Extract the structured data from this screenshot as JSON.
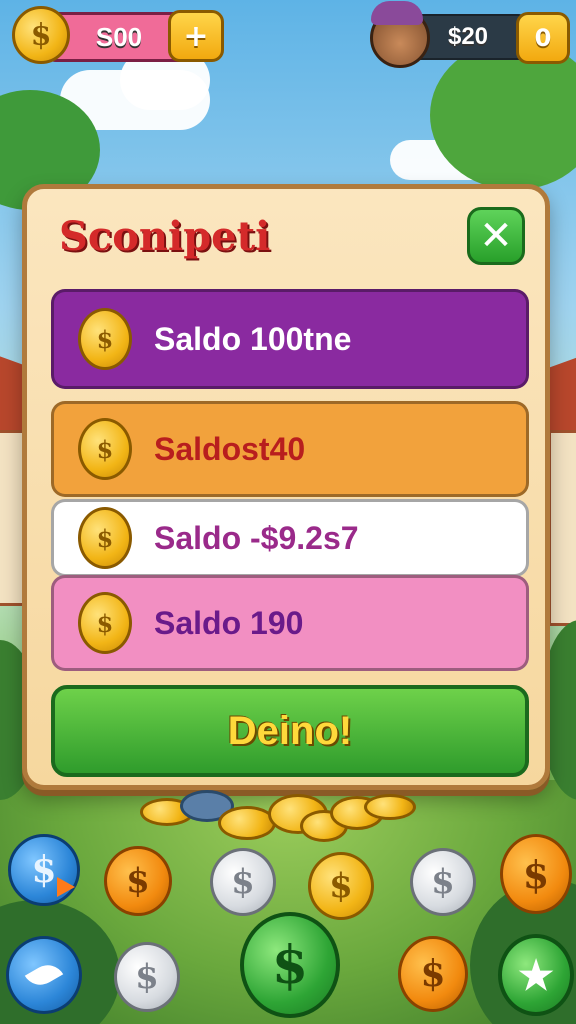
{
  "hud": {
    "coins_value": "S00",
    "coin_icon_glyph": "$",
    "plus_glyph": "+",
    "player_money": "$20",
    "player_counter": "0"
  },
  "modal": {
    "title": "Sconipeti",
    "close_glyph": "✕",
    "rows": [
      {
        "label": "Saldo 100tne",
        "color": "#8a2aa0",
        "text_color": "#ffffff"
      },
      {
        "label": "Saldost40",
        "color": "#f2a23c",
        "text_color": "#b81e1e"
      },
      {
        "label": "Saldo -$9.2s7",
        "color": "#ffffff",
        "text_color": "#9a2a8a"
      },
      {
        "label": "Saldo  190",
        "color": "#f28fc2",
        "text_color": "#6a1a8a"
      }
    ],
    "confirm_label": "Deino!"
  },
  "bottom": {
    "coin_glyph": "$",
    "star_glyph": "★"
  }
}
